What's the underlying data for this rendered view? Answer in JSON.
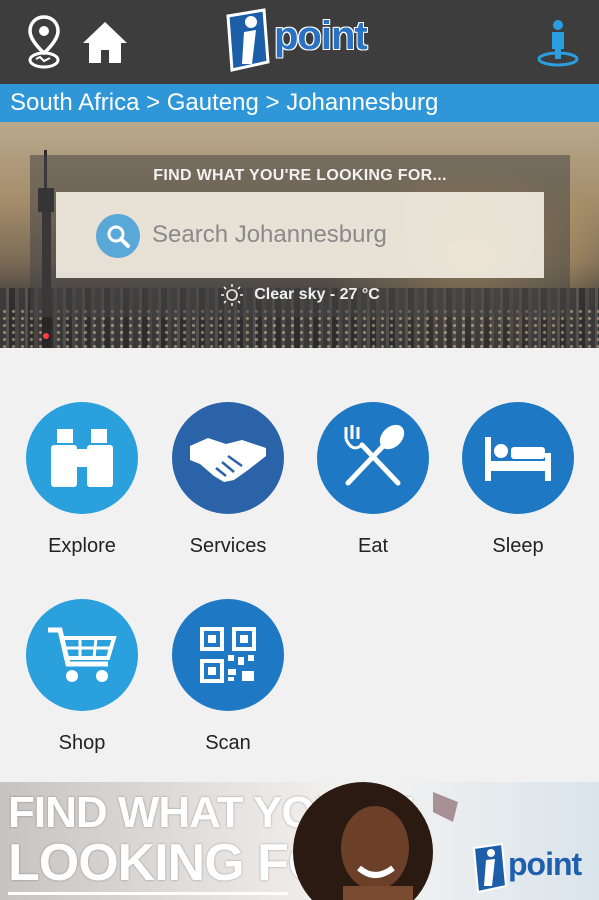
{
  "topbar": {
    "logo_text": "point",
    "icons": {
      "location": "location-pin-icon",
      "home": "home-icon",
      "profile": "person-location-icon"
    }
  },
  "breadcrumb": {
    "text": "South Africa > Gauteng > Johannesburg"
  },
  "hero": {
    "heading": "FIND WHAT YOU'RE LOOKING FOR...",
    "search_placeholder": "Search Johannesburg",
    "weather": "Clear sky - 27 °C"
  },
  "tiles": [
    {
      "label": "Explore",
      "icon": "binoculars-icon"
    },
    {
      "label": "Services",
      "icon": "handshake-icon"
    },
    {
      "label": "Eat",
      "icon": "fork-spoon-icon"
    },
    {
      "label": "Sleep",
      "icon": "bed-icon"
    },
    {
      "label": "Shop",
      "icon": "cart-icon"
    },
    {
      "label": "Scan",
      "icon": "qr-code-icon"
    }
  ],
  "banner": {
    "line1": "FIND WHAT YOU'RE",
    "line2": "LOOKING FOR...",
    "logo_text": "point"
  },
  "colors": {
    "topbar": "#3d3d3d",
    "breadcrumb": "#2f97d8",
    "tile_light_blue": "#2aa1dd",
    "tile_dark_blue": "#2a63a8",
    "tile_mid_blue": "#1f78c3"
  }
}
